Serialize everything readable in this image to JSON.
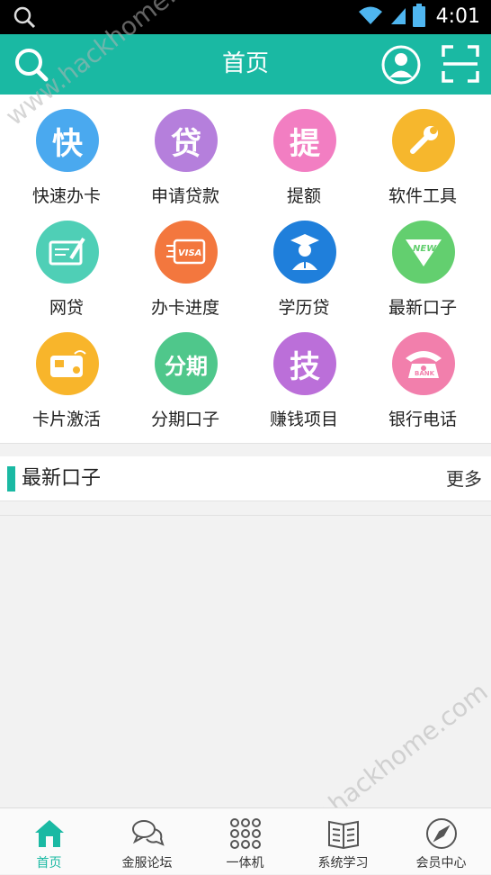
{
  "status_bar": {
    "time": "4:01"
  },
  "header": {
    "title": "首页"
  },
  "grid": [
    {
      "label": "快速办卡",
      "glyph": "快",
      "color": "#4aa9ef",
      "icon": "fast-card-icon"
    },
    {
      "label": "申请贷款",
      "glyph": "贷",
      "color": "#b57fdc",
      "icon": "loan-icon"
    },
    {
      "label": "提额",
      "glyph": "提",
      "color": "#f27ec2",
      "icon": "limit-raise-icon"
    },
    {
      "label": "软件工具",
      "glyph": "",
      "color": "#f6b72d",
      "icon": "wrench-icon"
    },
    {
      "label": "网贷",
      "glyph": "",
      "color": "#4fcfb6",
      "icon": "check-pen-icon"
    },
    {
      "label": "办卡进度",
      "glyph": "",
      "color": "#f3773e",
      "icon": "visa-card-icon"
    },
    {
      "label": "学历贷",
      "glyph": "",
      "color": "#1f7fdb",
      "icon": "graduate-icon"
    },
    {
      "label": "最新口子",
      "glyph": "",
      "color": "#63cf6f",
      "icon": "new-badge-icon"
    },
    {
      "label": "卡片激活",
      "glyph": "",
      "color": "#f8b52b",
      "icon": "card-activate-icon"
    },
    {
      "label": "分期口子",
      "glyph": "分期",
      "color": "#4fc78b",
      "icon": "installment-icon"
    },
    {
      "label": "赚钱项目",
      "glyph": "技",
      "color": "#bb6fd9",
      "icon": "earn-project-icon"
    },
    {
      "label": "银行电话",
      "glyph": "",
      "color": "#f27fac",
      "icon": "bank-phone-icon"
    }
  ],
  "section": {
    "title": "最新口子",
    "more": "更多"
  },
  "watermark": "www.hackhome.com",
  "tabs": [
    {
      "label": "首页",
      "icon": "home-icon",
      "active": true
    },
    {
      "label": "金服论坛",
      "icon": "chat-icon",
      "active": false
    },
    {
      "label": "一体机",
      "icon": "dots-grid-icon",
      "active": false
    },
    {
      "label": "系统学习",
      "icon": "book-icon",
      "active": false
    },
    {
      "label": "会员中心",
      "icon": "compass-icon",
      "active": false
    }
  ],
  "colors": {
    "accent": "#1ab9a3"
  }
}
